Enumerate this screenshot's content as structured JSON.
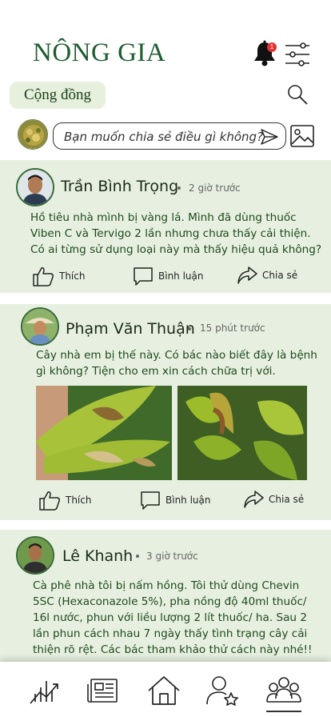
{
  "header": {
    "app_title": "NÔNG GIA",
    "notification_count": "1"
  },
  "community": {
    "chip_label": "Cộng đồng"
  },
  "composer": {
    "placeholder": "Bạn muốn chia sẻ điều gì không?"
  },
  "actions": {
    "like": "Thích",
    "comment": "Bình luận",
    "share": "Chia sẻ"
  },
  "posts": [
    {
      "author": "Trần Bình Trọng",
      "time": "2 giờ trước",
      "lines": [
        "Hồ tiêu nhà mình bị vàng lá. Mình đã dùng thuốc",
        "Viben C và Tervigo 2 lần nhưng chưa thấy cải thiện.",
        "Có ai từng sử dụng loại này mà thấy hiệu quả không?"
      ]
    },
    {
      "author": "Phạm Văn Thuận",
      "time": "15 phút trước",
      "lines": [
        "Cây nhà em bị thế này. Có bác nào biết đây là bệnh",
        "gì không? Tiện cho em xin cách chữa trị với."
      ]
    },
    {
      "author": "Lê Khanh",
      "time": "3 giờ trước",
      "lines": [
        "Cà phê nhà tôi bị nấm hồng. Tôi thử dùng Chevin",
        "5SC (Hexaconazole 5%), pha nồng độ 40ml thuốc/",
        "16l nước, phun với liều lượng 2 lít thuốc/ ha. Sau 2",
        "lần phun cách nhau 7 ngày thấy tình trạng cây cải",
        "thiện rõ rệt. Các bác tham khảo thử cách này nhé!!"
      ]
    }
  ],
  "tabbar": {
    "icons": [
      "chart-icon",
      "news-icon",
      "home-icon",
      "user-star-icon",
      "community-icon"
    ],
    "active": "community-icon"
  },
  "colors": {
    "brand": "#1e5c31",
    "card_bg": "#e7f0e0",
    "chip_bg": "#e6f0dc",
    "badge": "#e53232"
  }
}
